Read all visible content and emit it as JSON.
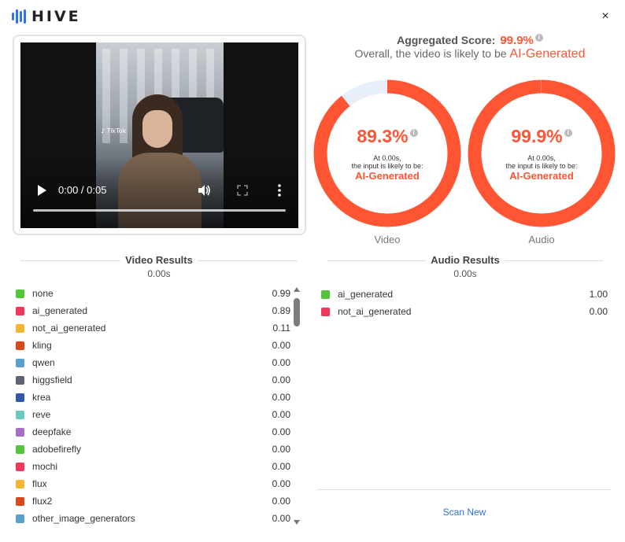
{
  "brand": {
    "name": "HIVE",
    "color": "#2f73e8"
  },
  "close_label": "×",
  "video_player": {
    "tag_text": "♪ TikTok",
    "time": "0:00 / 0:05"
  },
  "aggregate": {
    "label": "Aggregated Score:",
    "score": "99.9%",
    "summary_prefix": "Overall, the video is likely to be",
    "summary_verdict": "AI-Generated"
  },
  "rings": {
    "accent": "#ff5533",
    "track": "#e8eefa",
    "video": {
      "pct": "89.3%",
      "fraction": 0.893,
      "note_line1": "At 0.00s,",
      "note_line2": "the input is likely to be:",
      "verdict": "AI-Generated",
      "label": "Video"
    },
    "audio": {
      "pct": "99.9%",
      "fraction": 0.999,
      "note_line1": "At 0.00s,",
      "note_line2": "the input is likely to be:",
      "verdict": "AI-Generated",
      "label": "Audio"
    }
  },
  "video_results": {
    "title": "Video Results",
    "time": "0.00s",
    "rows": [
      {
        "label": "none",
        "value": "0.99",
        "color": "#55c43a"
      },
      {
        "label": "ai_generated",
        "value": "0.89",
        "color": "#f0385a"
      },
      {
        "label": "not_ai_generated",
        "value": "0.11",
        "color": "#f5b731"
      },
      {
        "label": "kling",
        "value": "0.00",
        "color": "#d64a1e"
      },
      {
        "label": "qwen",
        "value": "0.00",
        "color": "#5aa0cc"
      },
      {
        "label": "higgsfield",
        "value": "0.00",
        "color": "#5d6470"
      },
      {
        "label": "krea",
        "value": "0.00",
        "color": "#2e5aa8"
      },
      {
        "label": "reve",
        "value": "0.00",
        "color": "#6cc9bd"
      },
      {
        "label": "deepfake",
        "value": "0.00",
        "color": "#a86dc4"
      },
      {
        "label": "adobefirefly",
        "value": "0.00",
        "color": "#55c43a"
      },
      {
        "label": "mochi",
        "value": "0.00",
        "color": "#f0385a"
      },
      {
        "label": "flux",
        "value": "0.00",
        "color": "#f5b731"
      },
      {
        "label": "flux2",
        "value": "0.00",
        "color": "#d64a1e"
      },
      {
        "label": "other_image_generators",
        "value": "0.00",
        "color": "#5aa0cc"
      }
    ]
  },
  "audio_results": {
    "title": "Audio Results",
    "time": "0.00s",
    "rows": [
      {
        "label": "ai_generated",
        "value": "1.00",
        "color": "#55c43a"
      },
      {
        "label": "not_ai_generated",
        "value": "0.00",
        "color": "#f0385a"
      }
    ]
  },
  "scan_new_label": "Scan New"
}
